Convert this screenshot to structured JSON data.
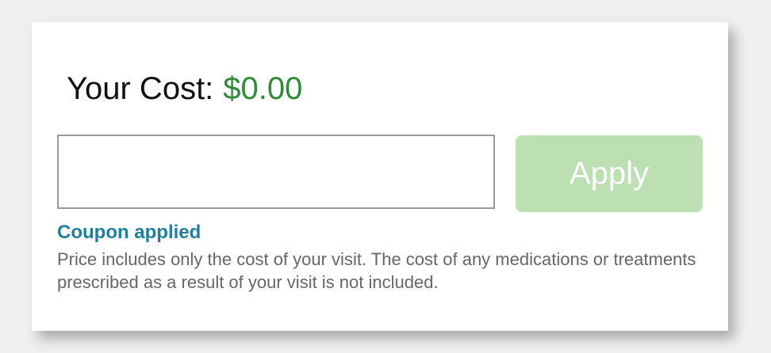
{
  "cost": {
    "label": "Your Cost:",
    "value": "$0.00",
    "value_color": "#2e8b3a"
  },
  "coupon": {
    "input_value": "",
    "apply_label": "Apply",
    "apply_color": "#bde0b3",
    "status": "Coupon applied",
    "status_color": "#1f7f9d"
  },
  "disclaimer": "Price includes only the cost of your visit. The cost of any medications or treatments prescribed as a result of your visit is not included."
}
